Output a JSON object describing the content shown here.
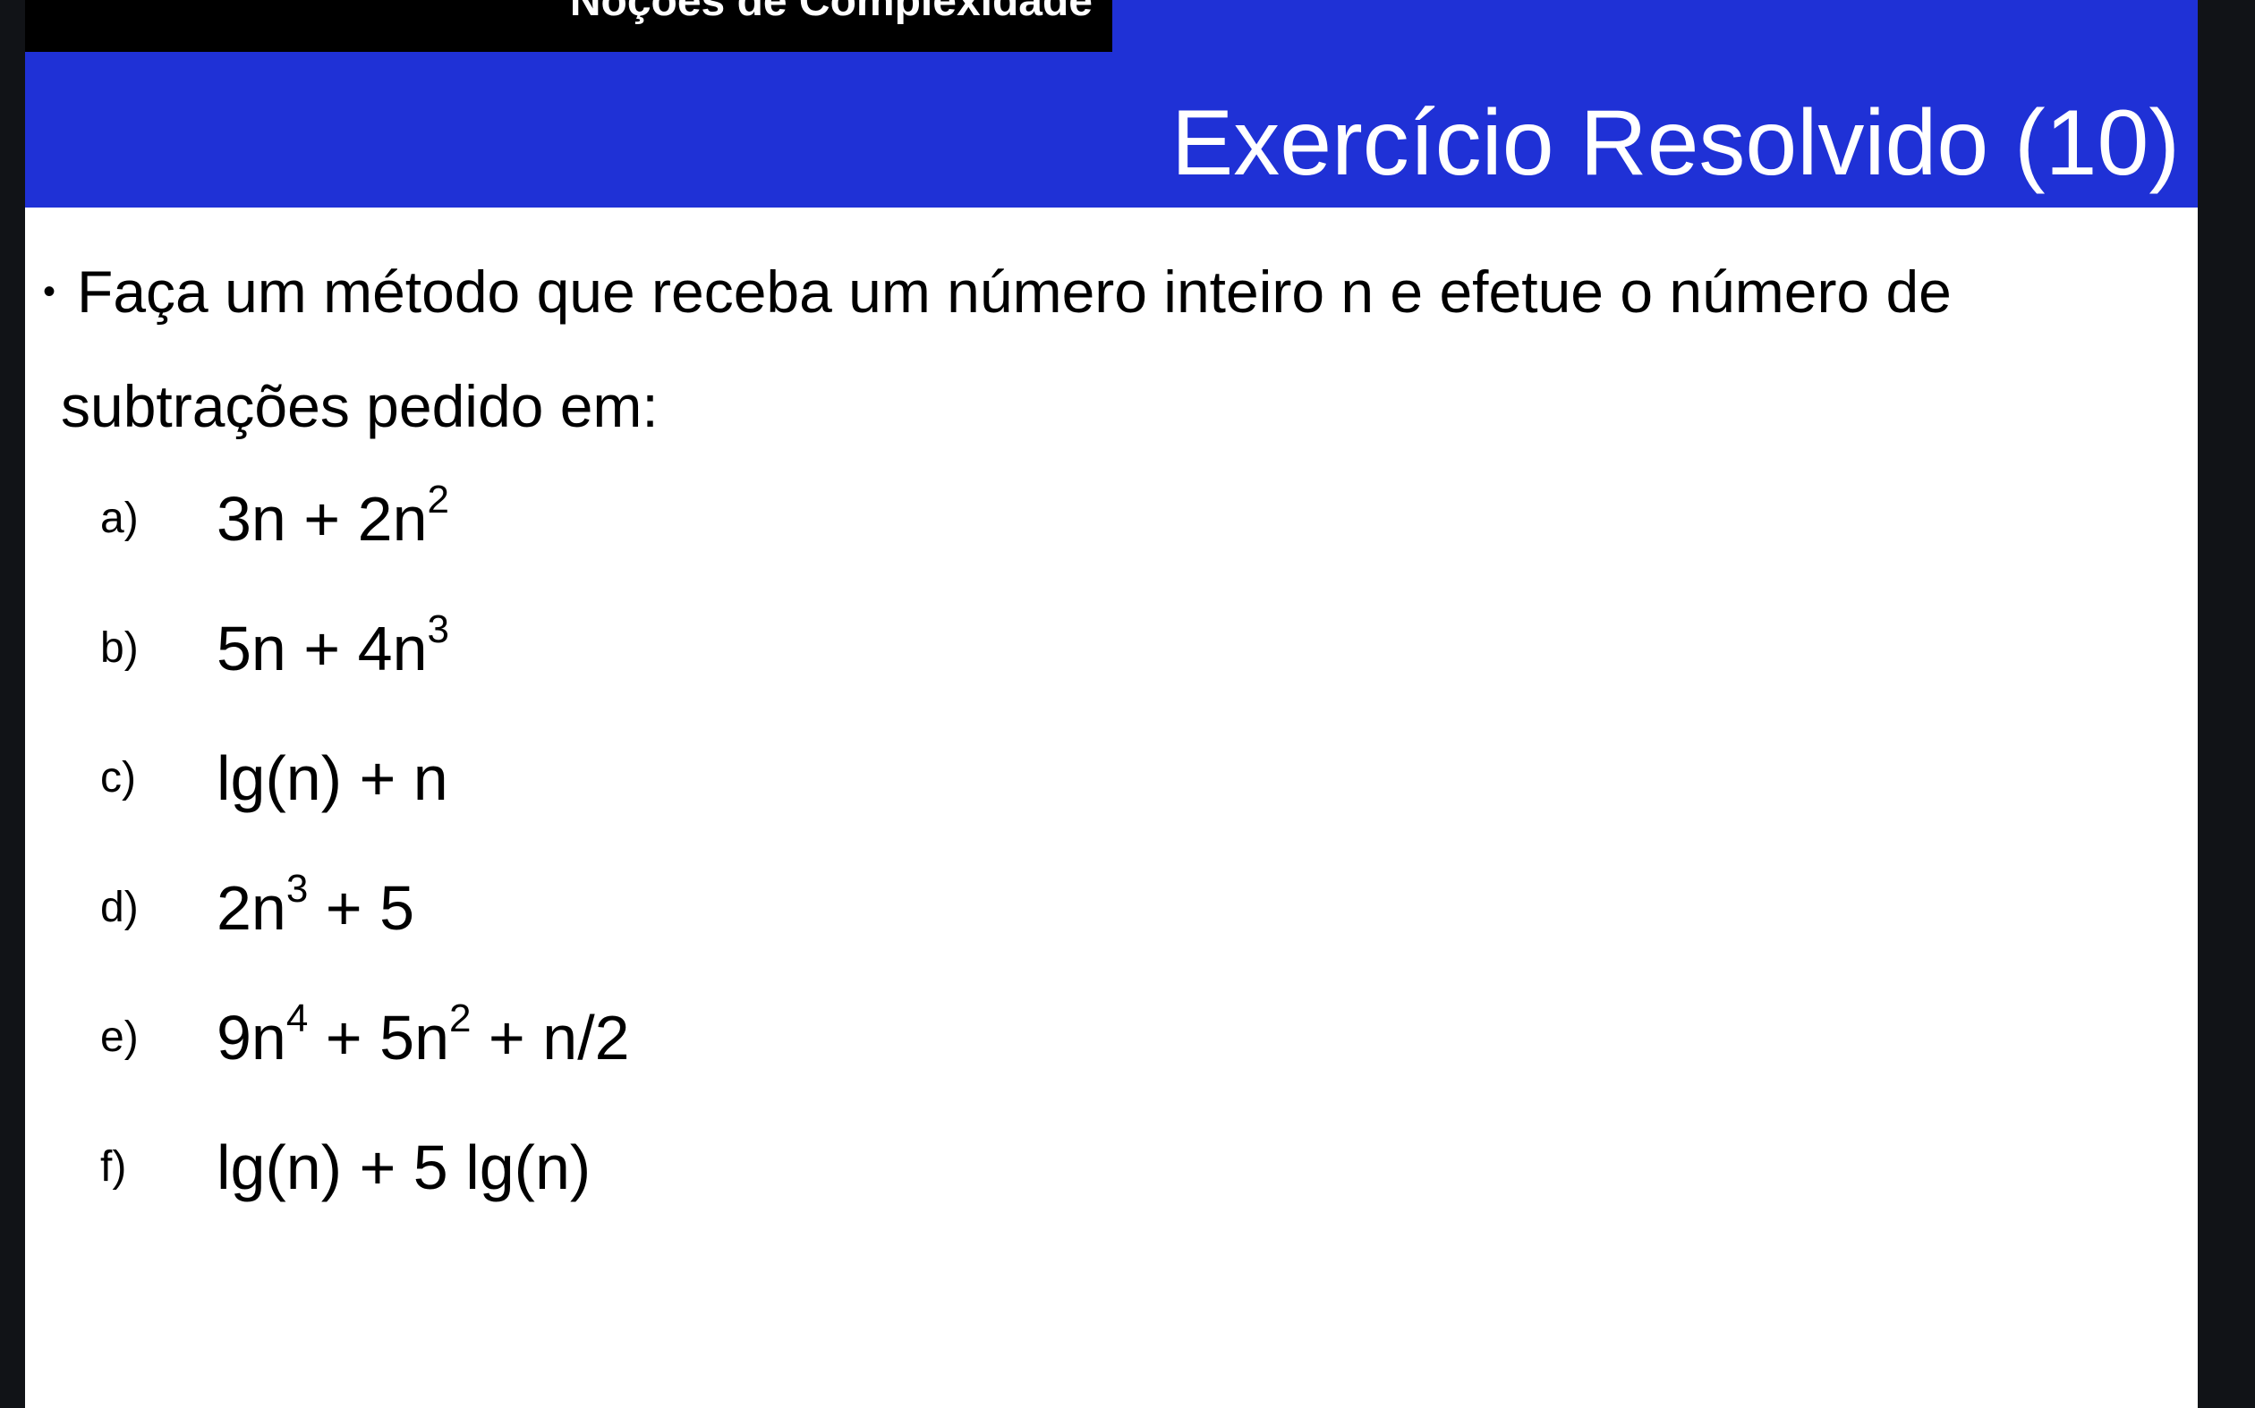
{
  "header": {
    "section_label": "Noções de Complexidade",
    "title": "Exercício Resolvido (10)"
  },
  "bullet": {
    "line1": "Faça um método que receba um número inteiro n e efetue o número de",
    "line2": "subtrações pedido em:"
  },
  "items": [
    {
      "letter": "a)",
      "expr": [
        {
          "t": "3n + 2n"
        },
        {
          "sup": "2"
        }
      ]
    },
    {
      "letter": "b)",
      "expr": [
        {
          "t": "5n + 4n"
        },
        {
          "sup": "3"
        }
      ]
    },
    {
      "letter": "c)",
      "expr": [
        {
          "t": "lg(n) + n"
        }
      ]
    },
    {
      "letter": "d)",
      "expr": [
        {
          "t": "2n"
        },
        {
          "sup": "3"
        },
        {
          "t": " + 5"
        }
      ]
    },
    {
      "letter": "e)",
      "expr": [
        {
          "t": "9n"
        },
        {
          "sup": "4"
        },
        {
          "t": " + 5n"
        },
        {
          "sup": "2"
        },
        {
          "t": " + n/2"
        }
      ]
    },
    {
      "letter": "f)",
      "expr": [
        {
          "t": "lg(n) + 5 lg(n)"
        }
      ]
    }
  ],
  "colors": {
    "header_blue": "#1f31d6",
    "tab_black": "#000000",
    "frame_dark": "#111317"
  }
}
